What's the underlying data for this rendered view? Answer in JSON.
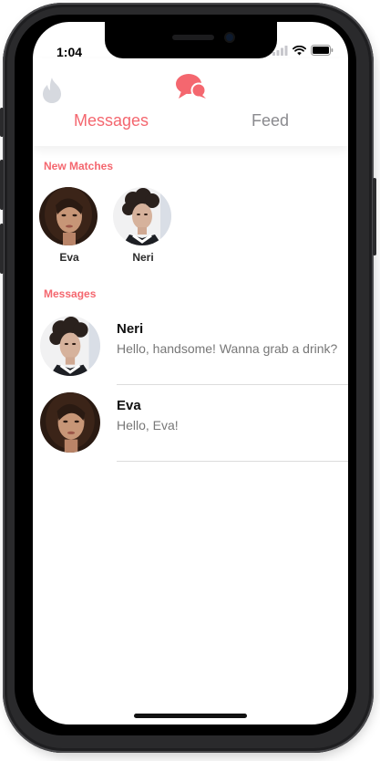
{
  "status_bar": {
    "time": "1:04"
  },
  "header": {
    "tabs": [
      {
        "label": "Messages",
        "active": true
      },
      {
        "label": "Feed",
        "active": false
      }
    ],
    "accent_color": "#f4676f"
  },
  "new_matches": {
    "title": "New Matches",
    "items": [
      {
        "name": "Eva"
      },
      {
        "name": "Neri"
      }
    ]
  },
  "messages": {
    "title": "Messages",
    "items": [
      {
        "name": "Neri",
        "preview": "Hello, handsome! Wanna grab a drink?"
      },
      {
        "name": "Eva",
        "preview": "Hello, Eva!"
      }
    ]
  }
}
